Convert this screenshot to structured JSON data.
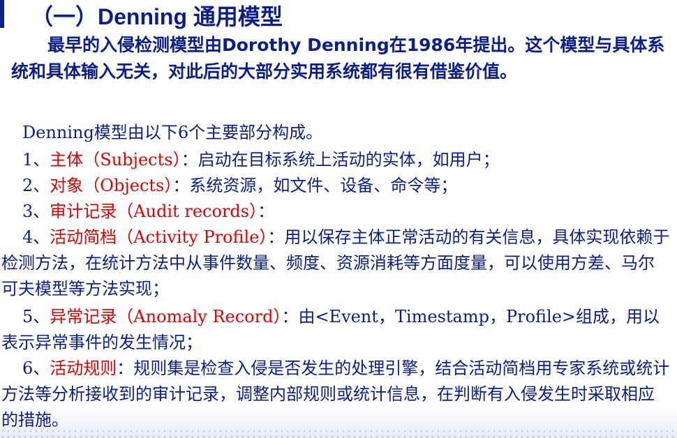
{
  "title": "（一）Denning 通用模型",
  "intro": "最早的入侵检测模型由Dorothy Denning在1986年提出。这个模型与具体系统和具体输入无关，对此后的大部分实用系统都有很有借鉴价值。",
  "lead": "Denning模型由以下6个主要部分构成。",
  "items": [
    {
      "num": "1、",
      "term": "主体（Subjects）",
      "desc": "：启动在目标系统上活动的实体，如用户；"
    },
    {
      "num": "2、",
      "term": "对象（Objects）",
      "desc": "：系统资源，如文件、设备、命令等；"
    },
    {
      "num": "3、",
      "term": "审计记录（Audit records）",
      "desc": "："
    },
    {
      "num": "4、",
      "term": "活动简档（Activity Profile）",
      "desc": "：用以保存主体正常活动的有关信息，具体实现依赖于检测方法，在统计方法中从事件数量、频度、资源消耗等方面度量，可以使用方差、马尔可夫模型等方法实现；"
    },
    {
      "num": "5、",
      "term": "异常记录（Anomaly Record）",
      "desc": "：由<Event，Timestamp，Profile>组成，用以表示异常事件的发生情况；"
    },
    {
      "num": "6、",
      "term": "活动规则",
      "desc": "：规则集是检查入侵是否发生的处理引擎，结合活动简档用专家系统或统计方法等分析接收到的审计记录，调整内部规则或统计信息，在判断有入侵发生时采取相应的措施。"
    }
  ],
  "colors": {
    "text": "#0a1e8c",
    "highlight": "#e00000",
    "accent_bar": "#0a1e8c"
  }
}
